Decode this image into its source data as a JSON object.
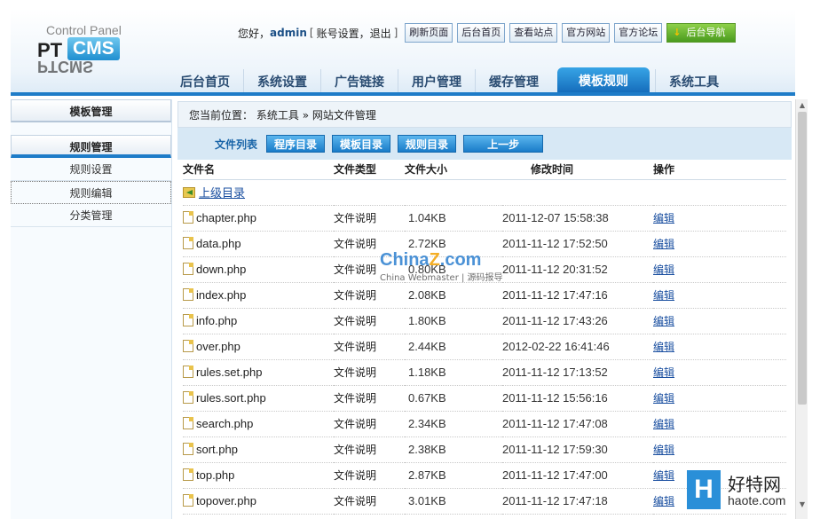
{
  "header": {
    "logo_top": "Control Panel",
    "logo_pt": "PT",
    "logo_cms": "CMS",
    "greeting": "您好，",
    "username": "admin",
    "links_open": "[",
    "account_settings": "账号设置",
    "comma": "，",
    "logout": "退出",
    "links_close": "]",
    "buttons": [
      "刷新页面",
      "后台首页",
      "查看站点",
      "官方网站",
      "官方论坛"
    ],
    "nav_button": "后台导航"
  },
  "tabs": [
    "后台首页",
    "系统设置",
    "广告链接",
    "用户管理",
    "缓存管理",
    "模板规则",
    "系统工具"
  ],
  "active_tab": "模板规则",
  "sidebar": {
    "section1": "模板管理",
    "section2": "规则管理",
    "items": [
      "规则设置",
      "规则编辑",
      "分类管理"
    ]
  },
  "breadcrumb": {
    "prefix": "您当前位置：",
    "level1": "系统工具",
    "arrow": "»",
    "level2": "网站文件管理"
  },
  "toolbar": {
    "label": "文件列表",
    "buttons": [
      "程序目录",
      "模板目录",
      "规则目录",
      "上一步"
    ]
  },
  "table": {
    "headers": [
      "文件名",
      "文件类型",
      "文件大小",
      "修改时间",
      "操作"
    ],
    "up_dir": "上级目录",
    "rows": [
      {
        "name": "chapter.php",
        "type": "文件说明",
        "size": "1.04KB",
        "time": "2011-12-07 15:58:38",
        "op": "编辑"
      },
      {
        "name": "data.php",
        "type": "文件说明",
        "size": "2.72KB",
        "time": "2011-11-12 17:52:50",
        "op": "编辑"
      },
      {
        "name": "down.php",
        "type": "文件说明",
        "size": "0.80KB",
        "time": "2011-11-12 20:31:52",
        "op": "编辑"
      },
      {
        "name": "index.php",
        "type": "文件说明",
        "size": "2.08KB",
        "time": "2011-11-12 17:47:16",
        "op": "编辑"
      },
      {
        "name": "info.php",
        "type": "文件说明",
        "size": "1.80KB",
        "time": "2011-11-12 17:43:26",
        "op": "编辑"
      },
      {
        "name": "over.php",
        "type": "文件说明",
        "size": "2.44KB",
        "time": "2012-02-22 16:41:46",
        "op": "编辑"
      },
      {
        "name": "rules.set.php",
        "type": "文件说明",
        "size": "1.18KB",
        "time": "2011-11-12 17:13:52",
        "op": "编辑"
      },
      {
        "name": "rules.sort.php",
        "type": "文件说明",
        "size": "0.67KB",
        "time": "2011-11-12 15:56:16",
        "op": "编辑"
      },
      {
        "name": "search.php",
        "type": "文件说明",
        "size": "2.34KB",
        "time": "2011-11-12 17:47:08",
        "op": "编辑"
      },
      {
        "name": "sort.php",
        "type": "文件说明",
        "size": "2.38KB",
        "time": "2011-11-12 17:59:30",
        "op": "编辑"
      },
      {
        "name": "top.php",
        "type": "文件说明",
        "size": "2.87KB",
        "time": "2011-11-12 17:47:00",
        "op": "编辑"
      },
      {
        "name": "topover.php",
        "type": "文件说明",
        "size": "3.01KB",
        "time": "2011-11-12 17:47:18",
        "op": "编辑"
      }
    ]
  },
  "watermarks": {
    "china": "China",
    "z": "Z",
    "com": ".com",
    "china_sub": "China Webmaster | 源码报导",
    "haote_cn": "好特网",
    "haote_url": "haote.com",
    "haote_h": "H"
  },
  "colors": {
    "accent": "#1e7cc8",
    "link": "#1a4fa0",
    "nav_green": "#4a9b1e"
  }
}
